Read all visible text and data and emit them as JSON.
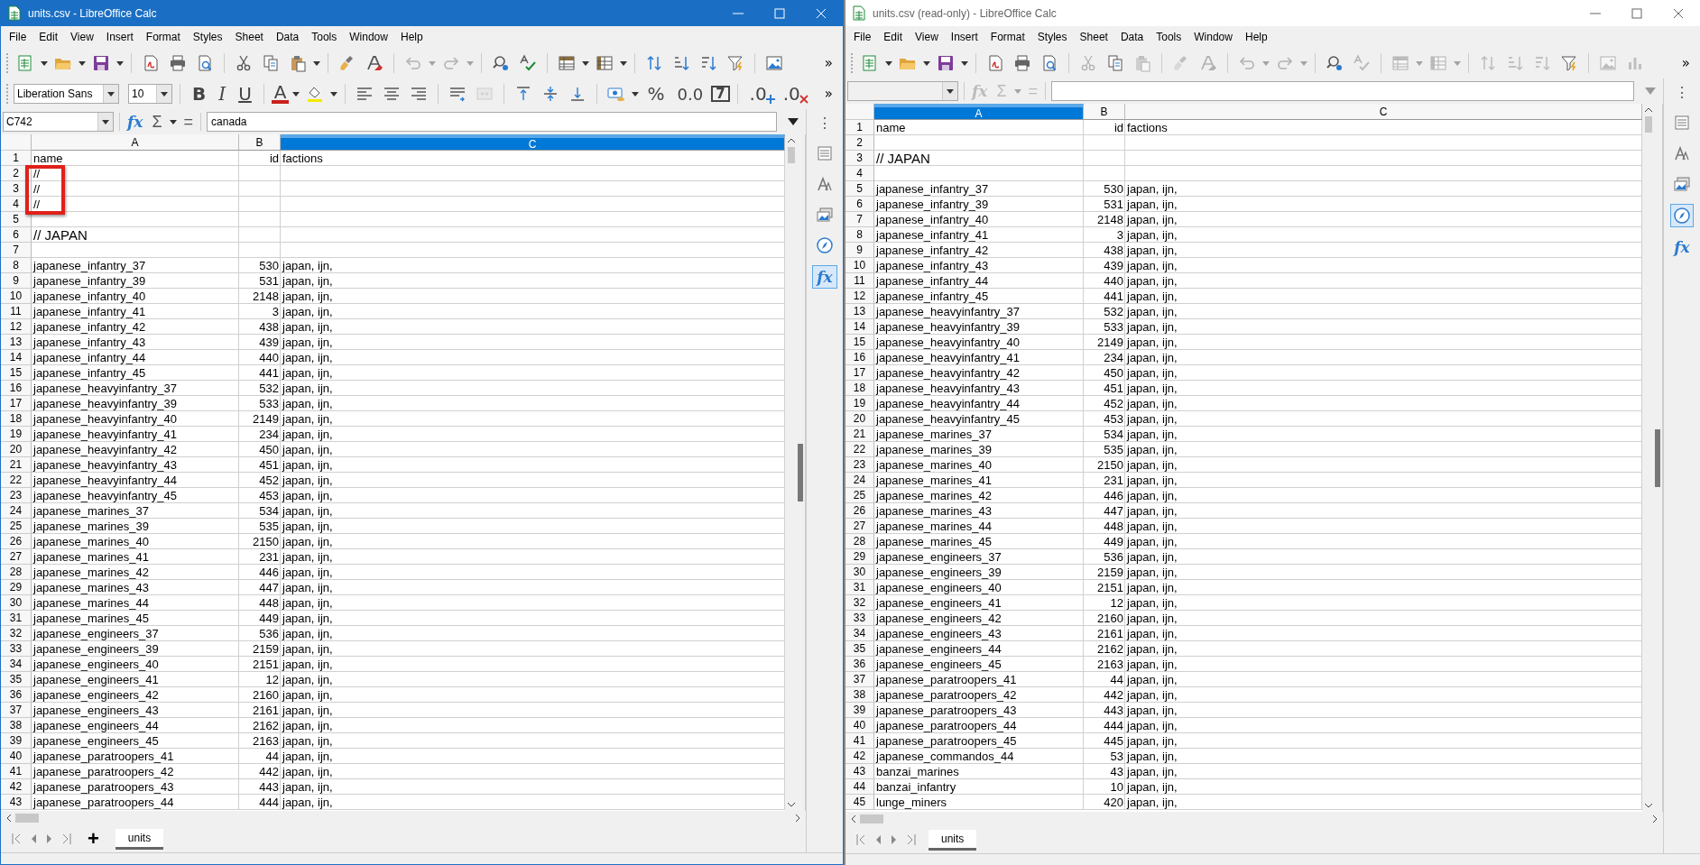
{
  "windows": [
    {
      "title": "units.csv - LibreOffice Calc",
      "active": true,
      "menu": [
        "File",
        "Edit",
        "View",
        "Insert",
        "Format",
        "Styles",
        "Sheet",
        "Data",
        "Tools",
        "Window",
        "Help"
      ],
      "toolbar": [
        {
          "kind": "new",
          "dropdown": true,
          "disabled": false
        },
        {
          "kind": "open",
          "dropdown": true,
          "disabled": false
        },
        {
          "kind": "save",
          "dropdown": true,
          "disabled": false
        },
        {
          "kind": "separator"
        },
        {
          "kind": "pdf",
          "dropdown": false,
          "disabled": false
        },
        {
          "kind": "print",
          "dropdown": false,
          "disabled": false
        },
        {
          "kind": "preview",
          "dropdown": false,
          "disabled": false
        },
        {
          "kind": "separator"
        },
        {
          "kind": "cut",
          "dropdown": false,
          "disabled": false
        },
        {
          "kind": "copy",
          "dropdown": false,
          "disabled": false
        },
        {
          "kind": "paste",
          "dropdown": true,
          "disabled": false
        },
        {
          "kind": "separator"
        },
        {
          "kind": "clone",
          "dropdown": false,
          "disabled": false
        },
        {
          "kind": "clear",
          "dropdown": false,
          "disabled": false
        },
        {
          "kind": "separator"
        },
        {
          "kind": "undo",
          "dropdown": true,
          "disabled": true
        },
        {
          "kind": "redo",
          "dropdown": true,
          "disabled": true
        },
        {
          "kind": "separator"
        },
        {
          "kind": "find",
          "dropdown": false,
          "disabled": false
        },
        {
          "kind": "spell",
          "dropdown": false,
          "disabled": false
        },
        {
          "kind": "separator"
        },
        {
          "kind": "rows",
          "dropdown": true,
          "disabled": false
        },
        {
          "kind": "cols",
          "dropdown": true,
          "disabled": false
        },
        {
          "kind": "separator"
        },
        {
          "kind": "sort",
          "dropdown": false,
          "disabled": false
        },
        {
          "kind": "sortasc",
          "dropdown": false,
          "disabled": false
        },
        {
          "kind": "sortdesc",
          "dropdown": false,
          "disabled": false
        },
        {
          "kind": "filter",
          "dropdown": false,
          "disabled": false
        },
        {
          "kind": "separator"
        },
        {
          "kind": "image",
          "dropdown": false,
          "disabled": false
        },
        {
          "kind": "more",
          "text": "»"
        }
      ],
      "format_toolbar": [
        {
          "kind": "font",
          "value": "Liberation Sans"
        },
        {
          "kind": "size",
          "value": "10"
        },
        {
          "kind": "separator"
        },
        {
          "kind": "bold",
          "text": "B"
        },
        {
          "kind": "italic",
          "text": "I"
        },
        {
          "kind": "underline",
          "text": "U"
        },
        {
          "kind": "separator"
        },
        {
          "kind": "fontcolor",
          "text": "A",
          "dropdown": true
        },
        {
          "kind": "highlight",
          "dropdown": true,
          "disabled": false
        },
        {
          "kind": "separator"
        },
        {
          "kind": "alignleft",
          "dropdown": false,
          "disabled": false
        },
        {
          "kind": "aligncenter",
          "dropdown": false,
          "disabled": false
        },
        {
          "kind": "alignright",
          "dropdown": false,
          "disabled": false
        },
        {
          "kind": "separator"
        },
        {
          "kind": "wrap",
          "dropdown": false,
          "disabled": false
        },
        {
          "kind": "merge",
          "dropdown": false,
          "disabled": true
        },
        {
          "kind": "separator"
        },
        {
          "kind": "vtop",
          "dropdown": false,
          "disabled": false
        },
        {
          "kind": "vcenter",
          "dropdown": false,
          "disabled": false
        },
        {
          "kind": "vbottom",
          "dropdown": false,
          "disabled": false
        },
        {
          "kind": "separator"
        },
        {
          "kind": "currency",
          "dropdown": true,
          "disabled": false
        },
        {
          "kind": "percent",
          "text": "%"
        },
        {
          "kind": "number",
          "text": "0.0"
        },
        {
          "kind": "date",
          "text": "7"
        },
        {
          "kind": "separator"
        },
        {
          "kind": "adddecimal",
          "text": ".0"
        },
        {
          "kind": "deldecimal",
          "text": ".0"
        },
        {
          "kind": "more",
          "text": "»"
        }
      ],
      "formula_bar": {
        "name_box": "C742",
        "function_wizard": "fx",
        "sum": "Σ",
        "equals": "=",
        "content": "canada",
        "disabled": false
      },
      "sidebar": [
        {
          "kind": "menu",
          "text": "⋮",
          "selected": false
        },
        {
          "kind": "properties",
          "selected": false
        },
        {
          "kind": "styles",
          "selected": false
        },
        {
          "kind": "gallery",
          "selected": false
        },
        {
          "kind": "navigator",
          "selected": false
        },
        {
          "kind": "functions",
          "text": "fx",
          "selected": true
        }
      ],
      "columns": [
        {
          "label": "A",
          "selected": false
        },
        {
          "label": "B",
          "selected": false
        },
        {
          "label": "C",
          "selected": true
        }
      ],
      "rows": [
        {
          "num": "1",
          "name": "name",
          "id": "id",
          "factions": "factions",
          "boxed": false
        },
        {
          "num": "2",
          "name": "//",
          "boxed": true
        },
        {
          "num": "3",
          "name": "//",
          "boxed": true
        },
        {
          "num": "4",
          "name": "//",
          "boxed": true
        },
        {
          "num": "5",
          "boxed": false
        },
        {
          "num": "6",
          "name": "// JAPAN",
          "boxed": false,
          "large": true
        },
        {
          "num": "7",
          "boxed": false
        },
        {
          "num": "8",
          "name": "japanese_infantry_37",
          "id": "530",
          "factions": "japan, ijn,",
          "boxed": false
        },
        {
          "num": "9",
          "name": "japanese_infantry_39",
          "id": "531",
          "factions": "japan, ijn,",
          "boxed": false
        },
        {
          "num": "10",
          "name": "japanese_infantry_40",
          "id": "2148",
          "factions": "japan, ijn,",
          "boxed": false
        },
        {
          "num": "11",
          "name": "japanese_infantry_41",
          "id": "3",
          "factions": "japan, ijn,",
          "boxed": false
        },
        {
          "num": "12",
          "name": "japanese_infantry_42",
          "id": "438",
          "factions": "japan, ijn,",
          "boxed": false
        },
        {
          "num": "13",
          "name": "japanese_infantry_43",
          "id": "439",
          "factions": "japan, ijn,",
          "boxed": false
        },
        {
          "num": "14",
          "name": "japanese_infantry_44",
          "id": "440",
          "factions": "japan, ijn,",
          "boxed": false
        },
        {
          "num": "15",
          "name": "japanese_infantry_45",
          "id": "441",
          "factions": "japan, ijn,",
          "boxed": false
        },
        {
          "num": "16",
          "name": "japanese_heavyinfantry_37",
          "id": "532",
          "factions": "japan, ijn,",
          "boxed": false
        },
        {
          "num": "17",
          "name": "japanese_heavyinfantry_39",
          "id": "533",
          "factions": "japan, ijn,",
          "boxed": false
        },
        {
          "num": "18",
          "name": "japanese_heavyinfantry_40",
          "id": "2149",
          "factions": "japan, ijn,",
          "boxed": false
        },
        {
          "num": "19",
          "name": "japanese_heavyinfantry_41",
          "id": "234",
          "factions": "japan, ijn,",
          "boxed": false
        },
        {
          "num": "20",
          "name": "japanese_heavyinfantry_42",
          "id": "450",
          "factions": "japan, ijn,",
          "boxed": false
        },
        {
          "num": "21",
          "name": "japanese_heavyinfantry_43",
          "id": "451",
          "factions": "japan, ijn,",
          "boxed": false
        },
        {
          "num": "22",
          "name": "japanese_heavyinfantry_44",
          "id": "452",
          "factions": "japan, ijn,",
          "boxed": false
        },
        {
          "num": "23",
          "name": "japanese_heavyinfantry_45",
          "id": "453",
          "factions": "japan, ijn,",
          "boxed": false
        },
        {
          "num": "24",
          "name": "japanese_marines_37",
          "id": "534",
          "factions": "japan, ijn,",
          "boxed": false
        },
        {
          "num": "25",
          "name": "japanese_marines_39",
          "id": "535",
          "factions": "japan, ijn,",
          "boxed": false
        },
        {
          "num": "26",
          "name": "japanese_marines_40",
          "id": "2150",
          "factions": "japan, ijn,",
          "boxed": false
        },
        {
          "num": "27",
          "name": "japanese_marines_41",
          "id": "231",
          "factions": "japan, ijn,",
          "boxed": false
        },
        {
          "num": "28",
          "name": "japanese_marines_42",
          "id": "446",
          "factions": "japan, ijn,",
          "boxed": false
        },
        {
          "num": "29",
          "name": "japanese_marines_43",
          "id": "447",
          "factions": "japan, ijn,",
          "boxed": false
        },
        {
          "num": "30",
          "name": "japanese_marines_44",
          "id": "448",
          "factions": "japan, ijn,",
          "boxed": false
        },
        {
          "num": "31",
          "name": "japanese_marines_45",
          "id": "449",
          "factions": "japan, ijn,",
          "boxed": false
        },
        {
          "num": "32",
          "name": "japanese_engineers_37",
          "id": "536",
          "factions": "japan, ijn,",
          "boxed": false
        },
        {
          "num": "33",
          "name": "japanese_engineers_39",
          "id": "2159",
          "factions": "japan, ijn,",
          "boxed": false
        },
        {
          "num": "34",
          "name": "japanese_engineers_40",
          "id": "2151",
          "factions": "japan, ijn,",
          "boxed": false
        },
        {
          "num": "35",
          "name": "japanese_engineers_41",
          "id": "12",
          "factions": "japan, ijn,",
          "boxed": false
        },
        {
          "num": "36",
          "name": "japanese_engineers_42",
          "id": "2160",
          "factions": "japan, ijn,",
          "boxed": false
        },
        {
          "num": "37",
          "name": "japanese_engineers_43",
          "id": "2161",
          "factions": "japan, ijn,",
          "boxed": false
        },
        {
          "num": "38",
          "name": "japanese_engineers_44",
          "id": "2162",
          "factions": "japan, ijn,",
          "boxed": false
        },
        {
          "num": "39",
          "name": "japanese_engineers_45",
          "id": "2163",
          "factions": "japan, ijn,",
          "boxed": false
        },
        {
          "num": "40",
          "name": "japanese_paratroopers_41",
          "id": "44",
          "factions": "japan, ijn,",
          "boxed": false
        },
        {
          "num": "41",
          "name": "japanese_paratroopers_42",
          "id": "442",
          "factions": "japan, ijn,",
          "boxed": false
        },
        {
          "num": "42",
          "name": "japanese_paratroopers_43",
          "id": "443",
          "factions": "japan, ijn,",
          "boxed": false
        },
        {
          "num": "43",
          "name": "japanese_paratroopers_44",
          "id": "444",
          "factions": "japan, ijn,",
          "boxed": false
        }
      ],
      "sheet_tabs": [
        {
          "label": "units",
          "selected": true
        }
      ],
      "add_sheet": "+"
    },
    {
      "title": "units.csv (read-only) - LibreOffice Calc",
      "active": false,
      "menu": [
        "File",
        "Edit",
        "View",
        "Insert",
        "Format",
        "Styles",
        "Sheet",
        "Data",
        "Tools",
        "Window",
        "Help"
      ],
      "toolbar": [
        {
          "kind": "new",
          "dropdown": true,
          "disabled": false
        },
        {
          "kind": "open",
          "dropdown": true,
          "disabled": false
        },
        {
          "kind": "save",
          "dropdown": true,
          "disabled": false
        },
        {
          "kind": "separator"
        },
        {
          "kind": "pdf",
          "dropdown": false,
          "disabled": false
        },
        {
          "kind": "print",
          "dropdown": false,
          "disabled": false
        },
        {
          "kind": "preview",
          "dropdown": false,
          "disabled": false
        },
        {
          "kind": "separator"
        },
        {
          "kind": "cut",
          "dropdown": false,
          "disabled": true
        },
        {
          "kind": "copy",
          "dropdown": false,
          "disabled": false
        },
        {
          "kind": "paste",
          "dropdown": false,
          "disabled": true
        },
        {
          "kind": "separator"
        },
        {
          "kind": "clone",
          "dropdown": false,
          "disabled": true
        },
        {
          "kind": "clear",
          "dropdown": false,
          "disabled": true
        },
        {
          "kind": "separator"
        },
        {
          "kind": "undo",
          "dropdown": true,
          "disabled": true
        },
        {
          "kind": "redo",
          "dropdown": true,
          "disabled": true
        },
        {
          "kind": "separator"
        },
        {
          "kind": "find",
          "dropdown": false,
          "disabled": false
        },
        {
          "kind": "spell",
          "dropdown": false,
          "disabled": true
        },
        {
          "kind": "separator"
        },
        {
          "kind": "rows",
          "dropdown": true,
          "disabled": true
        },
        {
          "kind": "cols",
          "dropdown": true,
          "disabled": true
        },
        {
          "kind": "separator"
        },
        {
          "kind": "sort",
          "dropdown": false,
          "disabled": true
        },
        {
          "kind": "sortasc",
          "dropdown": false,
          "disabled": true
        },
        {
          "kind": "sortdesc",
          "dropdown": false,
          "disabled": true
        },
        {
          "kind": "filter",
          "dropdown": false,
          "disabled": false
        },
        {
          "kind": "separator"
        },
        {
          "kind": "image",
          "dropdown": false,
          "disabled": true
        },
        {
          "kind": "chart",
          "dropdown": false,
          "disabled": true
        },
        {
          "kind": "more",
          "text": "»"
        }
      ],
      "formula_bar": {
        "function_wizard": "fx",
        "sum": "Σ",
        "equals": "=",
        "disabled": true
      },
      "sidebar": [
        {
          "kind": "menu",
          "text": "⋮",
          "selected": false
        },
        {
          "kind": "properties",
          "selected": false
        },
        {
          "kind": "styles",
          "selected": false
        },
        {
          "kind": "gallery",
          "selected": false
        },
        {
          "kind": "navigator",
          "selected": true
        },
        {
          "kind": "functions",
          "text": "fx",
          "selected": false
        }
      ],
      "columns": [
        {
          "label": "A",
          "selected": true
        },
        {
          "label": "B",
          "selected": false
        },
        {
          "label": "C",
          "selected": false
        }
      ],
      "rows": [
        {
          "num": "1",
          "name": "name",
          "id": "id",
          "factions": "factions"
        },
        {
          "num": "2"
        },
        {
          "num": "3",
          "name": "// JAPAN",
          "large": true
        },
        {
          "num": "4"
        },
        {
          "num": "5",
          "name": "japanese_infantry_37",
          "id": "530",
          "factions": "japan, ijn,"
        },
        {
          "num": "6",
          "name": "japanese_infantry_39",
          "id": "531",
          "factions": "japan, ijn,"
        },
        {
          "num": "7",
          "name": "japanese_infantry_40",
          "id": "2148",
          "factions": "japan, ijn,"
        },
        {
          "num": "8",
          "name": "japanese_infantry_41",
          "id": "3",
          "factions": "japan, ijn,"
        },
        {
          "num": "9",
          "name": "japanese_infantry_42",
          "id": "438",
          "factions": "japan, ijn,"
        },
        {
          "num": "10",
          "name": "japanese_infantry_43",
          "id": "439",
          "factions": "japan, ijn,"
        },
        {
          "num": "11",
          "name": "japanese_infantry_44",
          "id": "440",
          "factions": "japan, ijn,"
        },
        {
          "num": "12",
          "name": "japanese_infantry_45",
          "id": "441",
          "factions": "japan, ijn,"
        },
        {
          "num": "13",
          "name": "japanese_heavyinfantry_37",
          "id": "532",
          "factions": "japan, ijn,"
        },
        {
          "num": "14",
          "name": "japanese_heavyinfantry_39",
          "id": "533",
          "factions": "japan, ijn,"
        },
        {
          "num": "15",
          "name": "japanese_heavyinfantry_40",
          "id": "2149",
          "factions": "japan, ijn,"
        },
        {
          "num": "16",
          "name": "japanese_heavyinfantry_41",
          "id": "234",
          "factions": "japan, ijn,"
        },
        {
          "num": "17",
          "name": "japanese_heavyinfantry_42",
          "id": "450",
          "factions": "japan, ijn,"
        },
        {
          "num": "18",
          "name": "japanese_heavyinfantry_43",
          "id": "451",
          "factions": "japan, ijn,"
        },
        {
          "num": "19",
          "name": "japanese_heavyinfantry_44",
          "id": "452",
          "factions": "japan, ijn,"
        },
        {
          "num": "20",
          "name": "japanese_heavyinfantry_45",
          "id": "453",
          "factions": "japan, ijn,"
        },
        {
          "num": "21",
          "name": "japanese_marines_37",
          "id": "534",
          "factions": "japan, ijn,"
        },
        {
          "num": "22",
          "name": "japanese_marines_39",
          "id": "535",
          "factions": "japan, ijn,"
        },
        {
          "num": "23",
          "name": "japanese_marines_40",
          "id": "2150",
          "factions": "japan, ijn,"
        },
        {
          "num": "24",
          "name": "japanese_marines_41",
          "id": "231",
          "factions": "japan, ijn,"
        },
        {
          "num": "25",
          "name": "japanese_marines_42",
          "id": "446",
          "factions": "japan, ijn,"
        },
        {
          "num": "26",
          "name": "japanese_marines_43",
          "id": "447",
          "factions": "japan, ijn,"
        },
        {
          "num": "27",
          "name": "japanese_marines_44",
          "id": "448",
          "factions": "japan, ijn,"
        },
        {
          "num": "28",
          "name": "japanese_marines_45",
          "id": "449",
          "factions": "japan, ijn,"
        },
        {
          "num": "29",
          "name": "japanese_engineers_37",
          "id": "536",
          "factions": "japan, ijn,"
        },
        {
          "num": "30",
          "name": "japanese_engineers_39",
          "id": "2159",
          "factions": "japan, ijn,"
        },
        {
          "num": "31",
          "name": "japanese_engineers_40",
          "id": "2151",
          "factions": "japan, ijn,"
        },
        {
          "num": "32",
          "name": "japanese_engineers_41",
          "id": "12",
          "factions": "japan, ijn,"
        },
        {
          "num": "33",
          "name": "japanese_engineers_42",
          "id": "2160",
          "factions": "japan, ijn,"
        },
        {
          "num": "34",
          "name": "japanese_engineers_43",
          "id": "2161",
          "factions": "japan, ijn,"
        },
        {
          "num": "35",
          "name": "japanese_engineers_44",
          "id": "2162",
          "factions": "japan, ijn,"
        },
        {
          "num": "36",
          "name": "japanese_engineers_45",
          "id": "2163",
          "factions": "japan, ijn,"
        },
        {
          "num": "37",
          "name": "japanese_paratroopers_41",
          "id": "44",
          "factions": "japan, ijn,"
        },
        {
          "num": "38",
          "name": "japanese_paratroopers_42",
          "id": "442",
          "factions": "japan, ijn,"
        },
        {
          "num": "39",
          "name": "japanese_paratroopers_43",
          "id": "443",
          "factions": "japan, ijn,"
        },
        {
          "num": "40",
          "name": "japanese_paratroopers_44",
          "id": "444",
          "factions": "japan, ijn,"
        },
        {
          "num": "41",
          "name": "japanese_paratroopers_45",
          "id": "445",
          "factions": "japan, ijn,"
        },
        {
          "num": "42",
          "name": "japanese_commandos_44",
          "id": "53",
          "factions": "japan, ijn,"
        },
        {
          "num": "43",
          "name": "banzai_marines",
          "id": "43",
          "factions": "japan, ijn,"
        },
        {
          "num": "44",
          "name": "banzai_infantry",
          "id": "10",
          "factions": "japan, ijn,"
        },
        {
          "num": "45",
          "name": "lunge_miners",
          "id": "420",
          "factions": "japan, ijn,"
        }
      ],
      "sheet_tabs": [
        {
          "label": "units",
          "selected": true
        }
      ]
    }
  ]
}
